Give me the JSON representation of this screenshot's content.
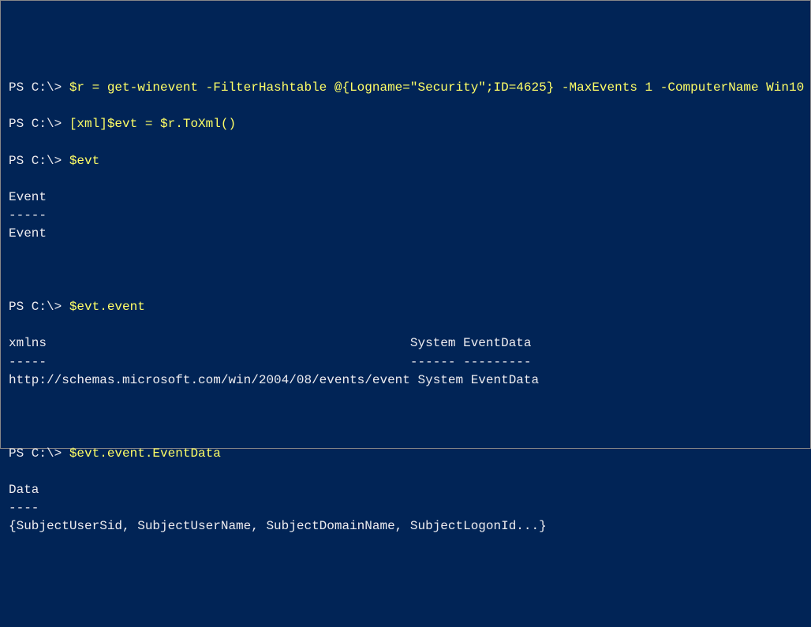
{
  "lines": [
    {
      "prompt": "PS C:\\> ",
      "cmd": "$r = get-winevent -FilterHashtable @{Logname=\"Security\";ID=4625} -MaxEvents 1 -ComputerName Win10"
    },
    {
      "blank": true
    },
    {
      "prompt": "PS C:\\> ",
      "cmd": "[xml]$evt = $r.ToXml()"
    },
    {
      "blank": true
    },
    {
      "prompt": "PS C:\\> ",
      "cmd": "$evt"
    },
    {
      "blank": true
    },
    {
      "out": "Event"
    },
    {
      "out": "-----"
    },
    {
      "out": "Event"
    },
    {
      "blank": true
    },
    {
      "blank": true
    },
    {
      "blank": true
    },
    {
      "prompt": "PS C:\\> ",
      "cmd": "$evt.event"
    },
    {
      "blank": true
    },
    {
      "out": "xmlns                                                System EventData"
    },
    {
      "out": "-----                                                ------ ---------"
    },
    {
      "out": "http://schemas.microsoft.com/win/2004/08/events/event System EventData"
    },
    {
      "blank": true
    },
    {
      "blank": true
    },
    {
      "blank": true
    },
    {
      "prompt": "PS C:\\> ",
      "cmd": "$evt.event.EventData"
    },
    {
      "blank": true
    },
    {
      "out": "Data"
    },
    {
      "out": "----"
    },
    {
      "out": "{SubjectUserSid, SubjectUserName, SubjectDomainName, SubjectLogonId...}"
    }
  ]
}
